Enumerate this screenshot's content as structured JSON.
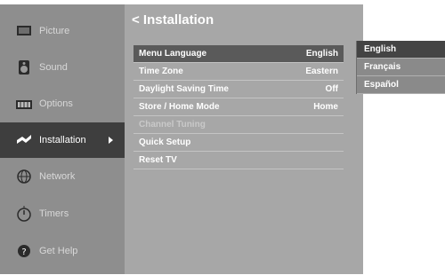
{
  "sidebar": {
    "items": [
      {
        "label": "Picture",
        "icon": "monitor-icon"
      },
      {
        "label": "Sound",
        "icon": "speaker-icon"
      },
      {
        "label": "Options",
        "icon": "keyboard-icon"
      },
      {
        "label": "Installation",
        "icon": "installation-icon"
      },
      {
        "label": "Network",
        "icon": "network-icon"
      },
      {
        "label": "Timers",
        "icon": "timer-icon"
      },
      {
        "label": "Get Help",
        "icon": "help-icon"
      }
    ]
  },
  "main": {
    "title": "< Installation",
    "items": [
      {
        "label": "Menu Language",
        "value": "English"
      },
      {
        "label": "Time Zone",
        "value": "Eastern"
      },
      {
        "label": "Daylight Saving Time",
        "value": "Off"
      },
      {
        "label": "Store / Home Mode",
        "value": "Home"
      },
      {
        "label": "Channel Tuning",
        "value": ""
      },
      {
        "label": "Quick Setup",
        "value": ""
      },
      {
        "label": "Reset TV",
        "value": ""
      }
    ]
  },
  "submenu": {
    "options": [
      "English",
      "Français",
      "Español"
    ]
  },
  "colors": {
    "sidebar_bg": "#8e8e8e",
    "sidebar_active": "#3e3e3e",
    "panel_bg": "#a7a7a7",
    "row_selected": "#5a5a5a",
    "text": "#ffffff"
  }
}
